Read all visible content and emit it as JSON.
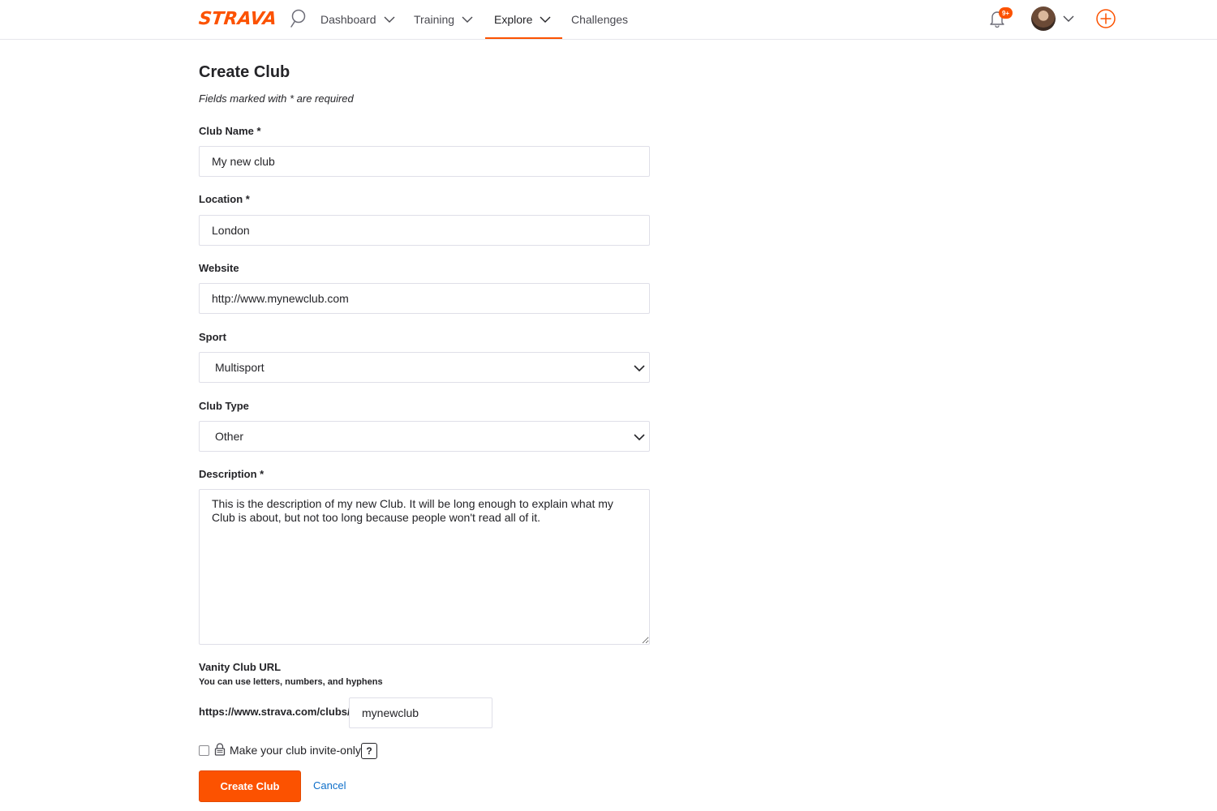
{
  "nav": {
    "logo": "STRAVA",
    "items": [
      {
        "label": "Dashboard"
      },
      {
        "label": "Training"
      },
      {
        "label": "Explore"
      },
      {
        "label": "Challenges"
      }
    ],
    "notification_badge": "9+",
    "accent": "#fc5200"
  },
  "form": {
    "title": "Create Club",
    "required_note": "Fields marked with * are required",
    "club_name": {
      "label": "Club Name *",
      "value": "My new club"
    },
    "location": {
      "label": "Location *",
      "value": "London"
    },
    "website": {
      "label": "Website",
      "value": "http://www.mynewclub.com"
    },
    "sport": {
      "label": "Sport",
      "value": "Multisport"
    },
    "club_type": {
      "label": "Club Type",
      "value": "Other"
    },
    "description": {
      "label": "Description *",
      "value": "This is the description of my new Club. It will be long enough to explain what my Club is about, but not too long because people won't read all of it."
    },
    "vanity": {
      "label": "Vanity Club URL",
      "hint": "You can use letters, numbers, and hyphens",
      "prefix": "https://www.strava.com/clubs/",
      "value": "mynewclub"
    },
    "invite_only_label": "Make your club invite-only",
    "help_label": "?",
    "submit_label": "Create Club",
    "cancel_label": "Cancel"
  }
}
